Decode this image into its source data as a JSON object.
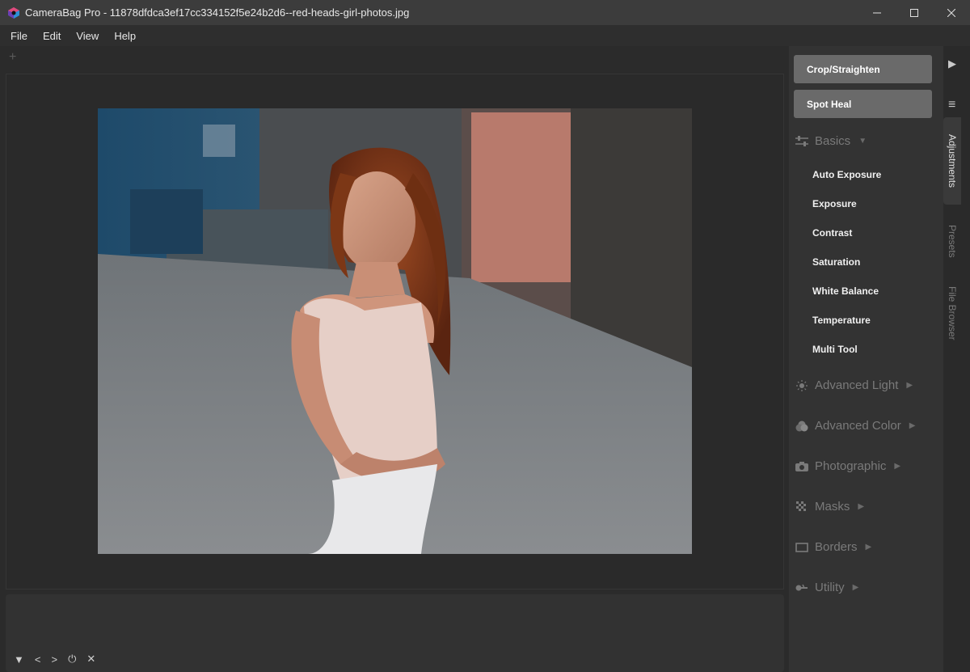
{
  "window": {
    "title": "CameraBag Pro - 11878dfdca3ef17cc334152f5e24b2d6--red-heads-girl-photos.jpg",
    "minimize": "─",
    "maximize": "☐",
    "close": "✕"
  },
  "menu": [
    "File",
    "Edit",
    "View",
    "Help"
  ],
  "tabs": {
    "add": "+"
  },
  "tools": {
    "crop": "Crop/Straighten",
    "spot_heal": "Spot Heal"
  },
  "basics": {
    "label": "Basics",
    "items": [
      "Auto Exposure",
      "Exposure",
      "Contrast",
      "Saturation",
      "White Balance",
      "Temperature",
      "Multi Tool"
    ]
  },
  "sections": {
    "advanced_light": "Advanced Light",
    "advanced_color": "Advanced Color",
    "photographic": "Photographic",
    "masks": "Masks",
    "borders": "Borders",
    "utility": "Utility"
  },
  "side_tabs": {
    "adjustments": "Adjustments",
    "presets": "Presets",
    "file_browser": "File Browser"
  },
  "filmstrip_controls": {
    "collapse": "▼",
    "prev": "<",
    "next": ">",
    "power": "⏻",
    "close": "✕"
  },
  "icons": {
    "panel_toggle": "▶",
    "panel_menu": "≡"
  }
}
